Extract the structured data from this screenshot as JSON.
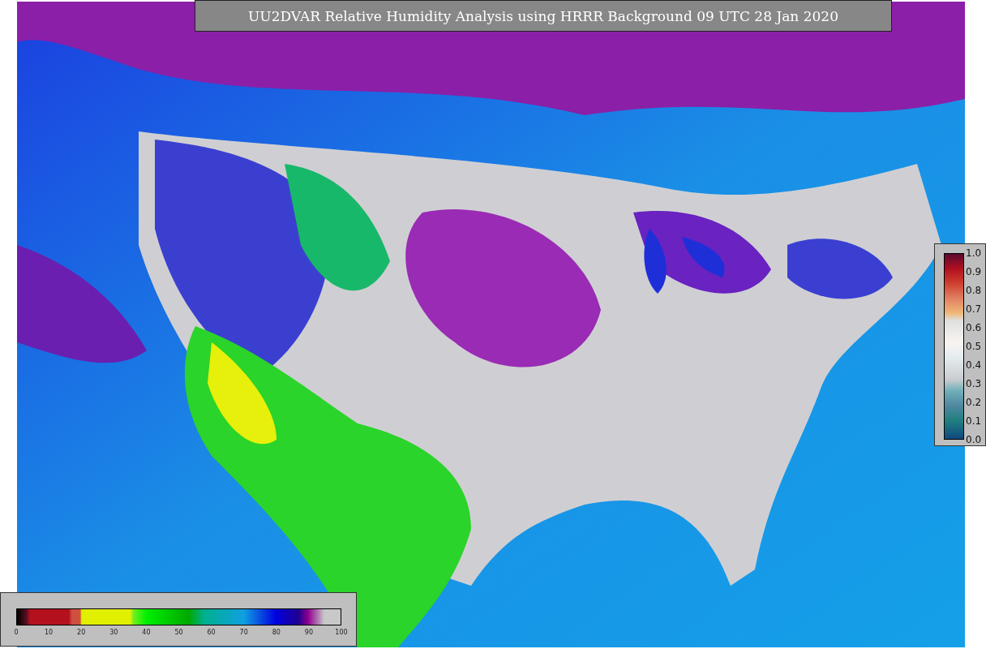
{
  "title": "UU2DVAR Relative Humidity Analysis using HRRR Background 09 UTC 28 Jan 2020",
  "observation_colorbar": {
    "ticks": [
      "1.0",
      "0.9",
      "0.8",
      "0.7",
      "0.6",
      "0.5",
      "0.4",
      "0.3",
      "0.2",
      "0.1",
      "0.0"
    ]
  },
  "humidity_colorbar": {
    "ticks": [
      "0",
      "10",
      "20",
      "30",
      "40",
      "50",
      "60",
      "70",
      "80",
      "90",
      "100"
    ]
  }
}
